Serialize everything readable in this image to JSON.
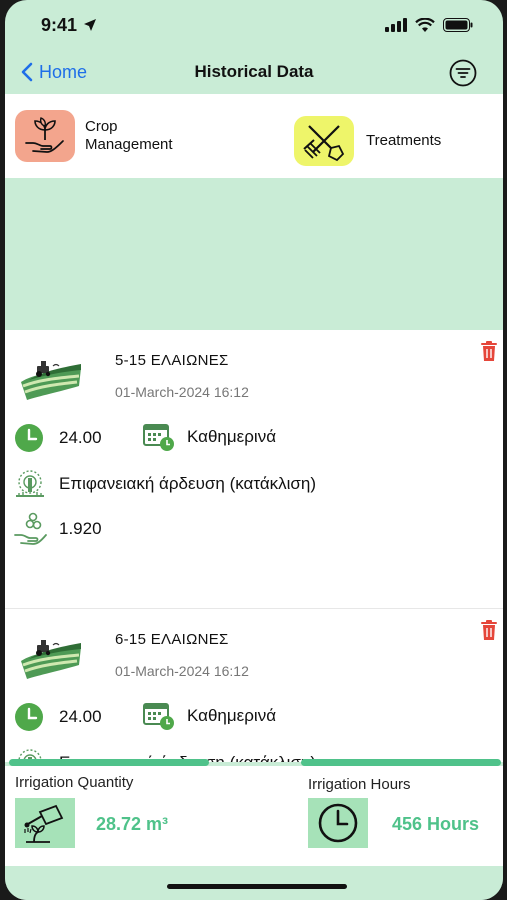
{
  "status_bar": {
    "time": "9:41"
  },
  "nav": {
    "back_label": "Home",
    "title": "Historical Data"
  },
  "categories": [
    {
      "label_line1": "Crop",
      "label_line2": "Management",
      "icon": "crop-hand-icon"
    },
    {
      "label_line1": "Treatments",
      "icon": "tools-icon"
    }
  ],
  "records": [
    {
      "title": "5-15 ΕΛΑΙΩΝΕΣ",
      "date": "01-March-2024 16:12",
      "hours": "24.00",
      "frequency": "Καθημερινά",
      "method": "Επιφανειακή άρδευση (κατάκλιση)",
      "cost": "1.920"
    },
    {
      "title": "6-15 ΕΛΑΙΩΝΕΣ",
      "date": "01-March-2024 16:12",
      "hours": "24.00",
      "frequency": "Καθημερινά",
      "method": "Επιφανειακή άρδευση (κατάκλιση)"
    }
  ],
  "summary": {
    "quantity_title": "Irrigation Quantity",
    "quantity_value": "28.72 m³",
    "hours_title": "Irrigation Hours",
    "hours_value": "456 Hours"
  },
  "colors": {
    "accent_green": "#4fc28a",
    "bg_green": "#c9ecd6",
    "ios_blue": "#1e6ee8",
    "trash_red": "#e5463a"
  }
}
